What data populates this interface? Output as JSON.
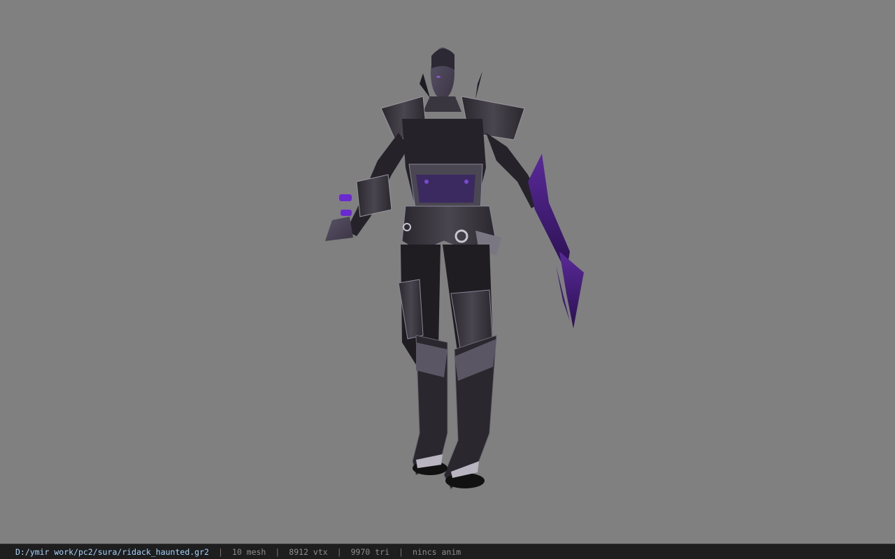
{
  "viewport": {
    "background_color": "#808080",
    "model_icon": "character-model"
  },
  "status_bar": {
    "file_path": "D:/ymir work/pc2/sura/ridack_haunted.gr2",
    "mesh_count": "10 mesh",
    "vertex_count": "8912 vtx",
    "triangle_count": "9970 tri",
    "animation": "nincs anim",
    "separator": "|",
    "path_color": "#a8d4ff"
  }
}
